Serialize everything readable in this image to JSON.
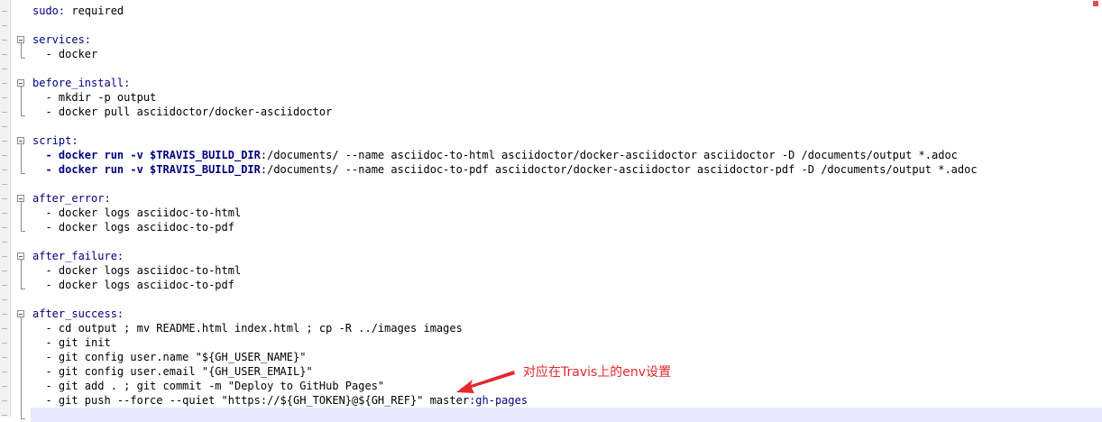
{
  "editor": {
    "lines": [
      {
        "indent": "",
        "key": "sudo",
        "sep": ": ",
        "value": "required",
        "type": "kv"
      },
      {
        "type": "blank"
      },
      {
        "indent": "",
        "key": "services",
        "sep": ":",
        "value": "",
        "type": "section"
      },
      {
        "indent": "  - ",
        "text": "docker",
        "type": "item"
      },
      {
        "type": "blank"
      },
      {
        "indent": "",
        "key": "before_install",
        "sep": ":",
        "value": "",
        "type": "section"
      },
      {
        "indent": "  - ",
        "text": "mkdir -p output",
        "type": "item"
      },
      {
        "indent": "  - ",
        "text": "docker pull asciidoctor/docker-asciidoctor",
        "type": "item"
      },
      {
        "type": "blank"
      },
      {
        "indent": "",
        "key": "script",
        "sep": ":",
        "value": "",
        "type": "section"
      },
      {
        "indent": "  - ",
        "bold": "docker run -v $TRAVIS_BUILD_DIR",
        "text": ":/documents/ --name asciidoc-to-html asciidoctor/docker-asciidoctor asciidoctor -D /documents/output *.adoc",
        "type": "item-bold"
      },
      {
        "indent": "  - ",
        "bold": "docker run -v $TRAVIS_BUILD_DIR",
        "text": ":/documents/ --name asciidoc-to-pdf asciidoctor/docker-asciidoctor asciidoctor-pdf -D /documents/output *.adoc",
        "type": "item-bold"
      },
      {
        "type": "blank"
      },
      {
        "indent": "",
        "key": "after_error",
        "sep": ":",
        "value": "",
        "type": "section"
      },
      {
        "indent": "  - ",
        "text": "docker logs asciidoc-to-html",
        "type": "item"
      },
      {
        "indent": "  - ",
        "text": "docker logs asciidoc-to-pdf",
        "type": "item"
      },
      {
        "type": "blank"
      },
      {
        "indent": "",
        "key": "after_failure",
        "sep": ":",
        "value": "",
        "type": "section"
      },
      {
        "indent": "  - ",
        "text": "docker logs asciidoc-to-html",
        "type": "item"
      },
      {
        "indent": "  - ",
        "text": "docker logs asciidoc-to-pdf",
        "type": "item"
      },
      {
        "type": "blank"
      },
      {
        "indent": "",
        "key": "after_success",
        "sep": ":",
        "value": "",
        "type": "section"
      },
      {
        "indent": "  - ",
        "text": "cd output ; mv README.html index.html ; cp -R ../images images",
        "type": "item"
      },
      {
        "indent": "  - ",
        "text": "git init",
        "type": "item"
      },
      {
        "indent": "  - ",
        "text": "git config user.name \"${GH_USER_NAME}\"",
        "type": "item"
      },
      {
        "indent": "  - ",
        "text": "git config user.email \"{GH_USER_EMAIL}\"",
        "type": "item"
      },
      {
        "indent": "  - ",
        "text": "git add . ; git commit -m \"Deploy to GitHub Pages\"",
        "type": "item"
      },
      {
        "indent": "  - ",
        "text": "git push --force --quiet \"https://${GH_TOKEN}@${GH_REF}\" master",
        "tail": ":gh-pages",
        "type": "item-tail"
      },
      {
        "type": "blank"
      }
    ]
  },
  "annotation": {
    "text": "对应在Travis上的env设置",
    "color": "#e5272d"
  },
  "colors": {
    "keyword": "#000080",
    "current_line": "#e8e8ff"
  }
}
